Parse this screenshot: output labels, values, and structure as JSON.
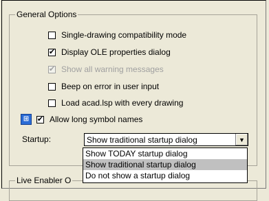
{
  "general_options": {
    "title": "General Options",
    "checkboxes": [
      {
        "label": "Single-drawing compatibility mode",
        "checked": false,
        "enabled": true
      },
      {
        "label": "Display OLE properties dialog",
        "checked": true,
        "enabled": true
      },
      {
        "label": "Show all warning messages",
        "checked": true,
        "enabled": false
      },
      {
        "label": "Beep on error in user input",
        "checked": false,
        "enabled": true
      },
      {
        "label": "Load acad.lsp with every drawing",
        "checked": false,
        "enabled": true
      },
      {
        "label": "Allow long symbol names",
        "checked": true,
        "enabled": true
      }
    ],
    "long_symbol_icon": "drawing-settings-icon"
  },
  "startup": {
    "label": "Startup:",
    "selected": "Show traditional startup dialog",
    "options": [
      "Show TODAY startup dialog",
      "Show traditional startup dialog",
      "Do not show a startup dialog"
    ]
  },
  "live_enabler": {
    "title": "Live Enabler O"
  },
  "colors": {
    "background": "#ece9d8",
    "selection": "#c0c0c0"
  }
}
